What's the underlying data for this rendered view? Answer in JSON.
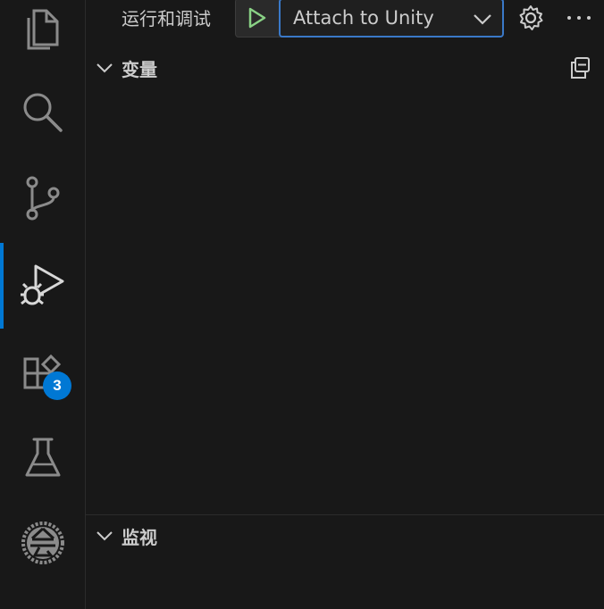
{
  "activity_bar": {
    "items": [
      {
        "icon": "explorer-icon"
      },
      {
        "icon": "search-icon"
      },
      {
        "icon": "source-control-icon"
      },
      {
        "icon": "run-debug-icon",
        "active": true
      },
      {
        "icon": "extensions-icon",
        "badge": "3"
      },
      {
        "icon": "testing-icon"
      },
      {
        "icon": "accounts-seal-icon"
      }
    ],
    "accent": "#0078d4",
    "extensions_badge": "3"
  },
  "toolbar": {
    "title": "运行和调试",
    "config_label": "Attach to Unity",
    "run_icon_color": "#89d185"
  },
  "sections": {
    "variables": {
      "title": "变量"
    },
    "watch": {
      "title": "监视"
    }
  }
}
